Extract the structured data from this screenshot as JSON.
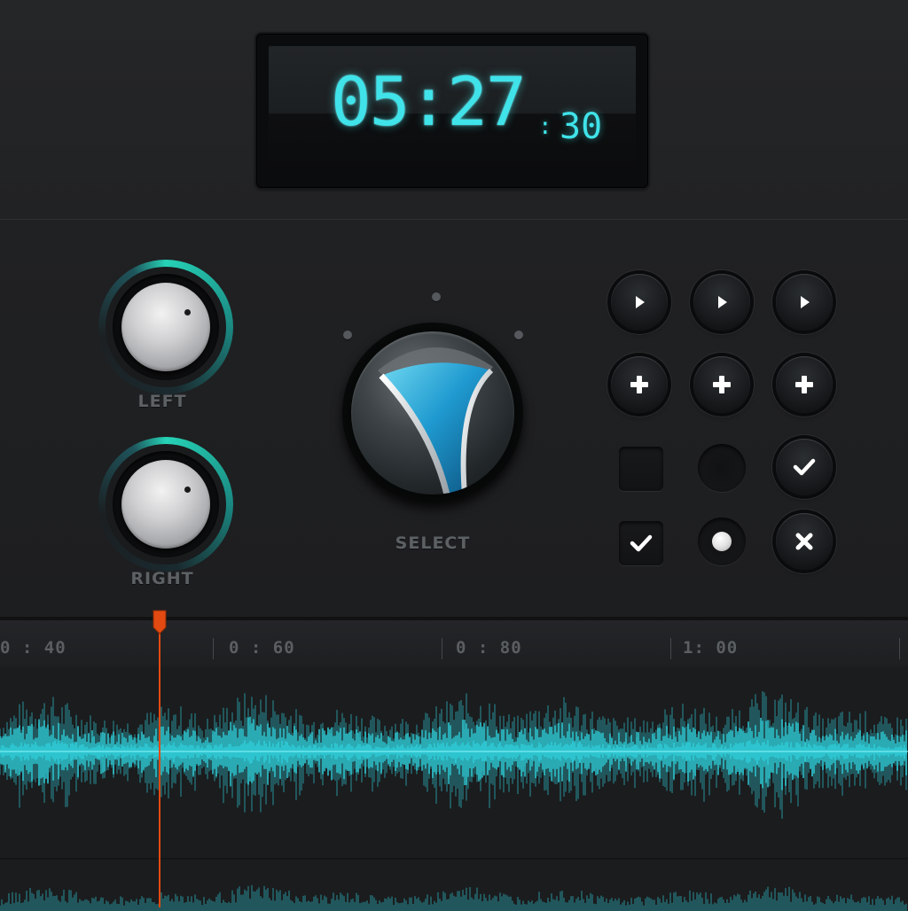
{
  "clock": {
    "main": "05:27",
    "separator": ":",
    "seconds": "30"
  },
  "knobs": {
    "left": {
      "label": "LEFT"
    },
    "right": {
      "label": "RIGHT"
    },
    "select": {
      "label": "SELECT"
    }
  },
  "buttons": {
    "row1": [
      "play-icon",
      "play-icon",
      "play-icon"
    ],
    "row2": [
      "plus-icon",
      "plus-icon",
      "plus-icon"
    ],
    "row3": [
      "empty-checkbox",
      "empty-radio",
      "check-icon"
    ],
    "row4": [
      "checked-checkbox",
      "selected-radio",
      "close-icon"
    ]
  },
  "timeline": {
    "labels": [
      "0 : 40",
      "0 : 60",
      "0 : 80",
      "1: 00"
    ]
  },
  "colors": {
    "lcd": "#3fe3e9",
    "accent_teal": "#26dcbe",
    "waveform": "#2ec6d1",
    "playhead": "#e24a12"
  }
}
